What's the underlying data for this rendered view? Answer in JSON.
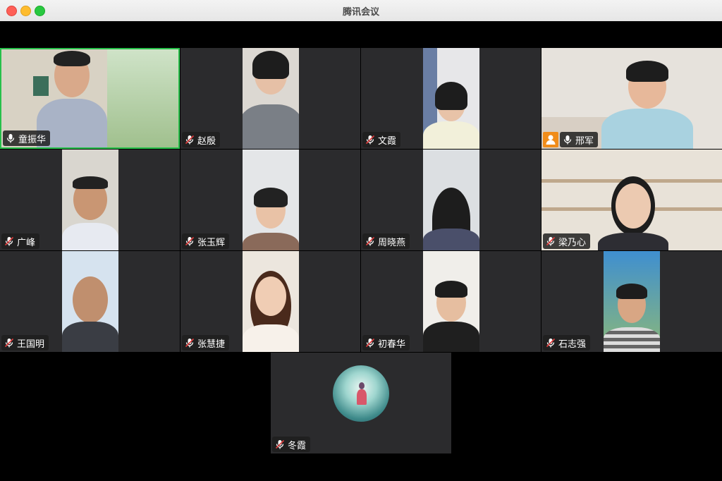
{
  "window": {
    "title": "腾讯会议"
  },
  "participants": [
    {
      "name": "童振华",
      "mic": "on",
      "speaking": true
    },
    {
      "name": "赵殷",
      "mic": "muted"
    },
    {
      "name": "文霞",
      "mic": "muted"
    },
    {
      "name": "邢军",
      "mic": "on",
      "host": true
    },
    {
      "name": "广峰",
      "mic": "muted"
    },
    {
      "name": "张玉辉",
      "mic": "muted"
    },
    {
      "name": "周晓燕",
      "mic": "muted"
    },
    {
      "name": "梁乃心",
      "mic": "muted"
    },
    {
      "name": "王国明",
      "mic": "muted"
    },
    {
      "name": "张慧捷",
      "mic": "muted"
    },
    {
      "name": "初春华",
      "mic": "muted"
    },
    {
      "name": "石志强",
      "mic": "muted"
    },
    {
      "name": "冬霞",
      "mic": "muted",
      "video": "off"
    }
  ],
  "colors": {
    "speaking_border": "#27c04a",
    "host_badge": "#f08c1a",
    "tile_bg": "#2b2b2d"
  },
  "icons": {
    "mic_on": "microphone-icon",
    "mic_off": "microphone-muted-icon",
    "host": "host-person-icon"
  }
}
